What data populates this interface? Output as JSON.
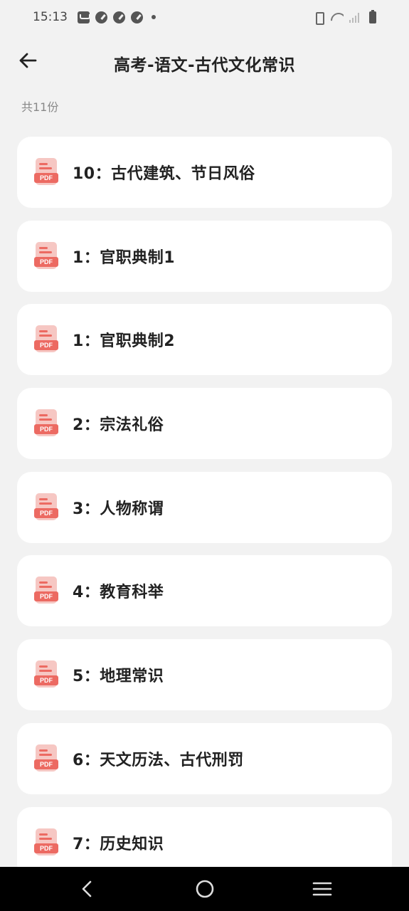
{
  "status_bar": {
    "time": "15:13",
    "left_icons": [
      "mail-icon",
      "notify-icon",
      "notify-icon",
      "notify-icon",
      "more-dot-icon"
    ],
    "right_icons": [
      "vibrate-icon",
      "wifi-icon",
      "signal-icon",
      "battery-icon"
    ]
  },
  "header": {
    "title": "高考-语文-古代文化常识",
    "back_icon": "arrow-left-icon"
  },
  "count_label": "共11份",
  "files": [
    {
      "name": "10：古代建筑、节日风俗",
      "icon": "pdf-icon"
    },
    {
      "name": "1：官职典制1",
      "icon": "pdf-icon"
    },
    {
      "name": "1：官职典制2",
      "icon": "pdf-icon"
    },
    {
      "name": "2：宗法礼俗",
      "icon": "pdf-icon"
    },
    {
      "name": "3：人物称谓",
      "icon": "pdf-icon"
    },
    {
      "name": "4：教育科举",
      "icon": "pdf-icon"
    },
    {
      "name": "5：地理常识",
      "icon": "pdf-icon"
    },
    {
      "name": "6：天文历法、古代刑罚",
      "icon": "pdf-icon"
    },
    {
      "name": "7：历史知识",
      "icon": "pdf-icon"
    }
  ],
  "pdf_badge": "PDF",
  "colors": {
    "background": "#f2f2f2",
    "card": "#ffffff",
    "pdf_accent": "#ec6a62",
    "pdf_light": "#f6c7c3",
    "nav_bar": "#000000"
  },
  "nav_bar": {
    "icons": [
      "nav-back-icon",
      "nav-home-icon",
      "nav-menu-icon"
    ]
  }
}
